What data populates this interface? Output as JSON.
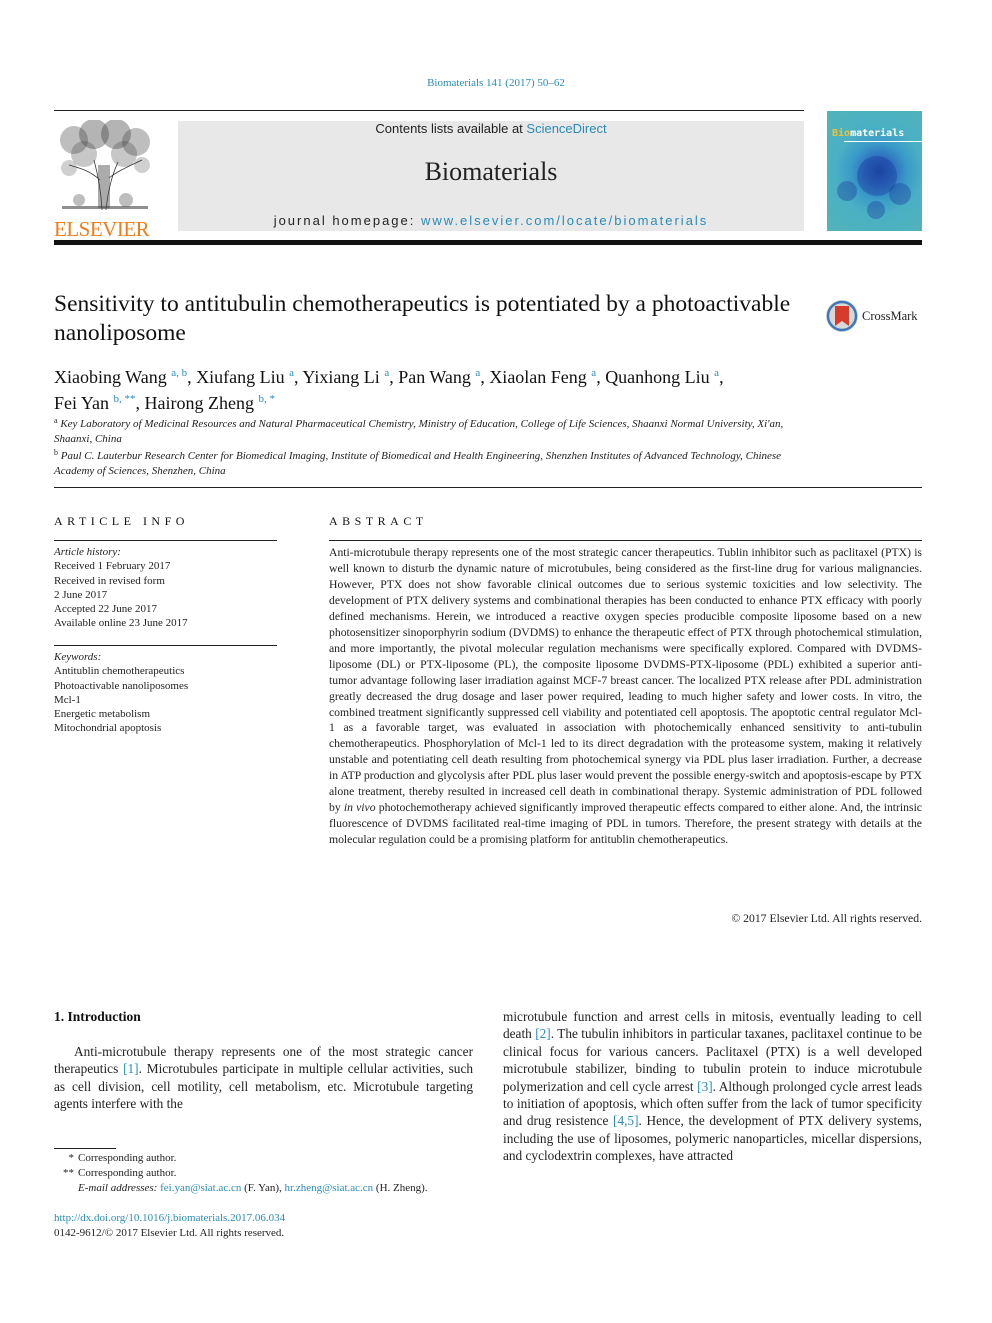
{
  "header": {
    "citation": "Biomaterials 141 (2017) 50–62",
    "publisher_logo_text": "ELSEVIER",
    "contents_prefix": "Contents lists available at ",
    "contents_link": "ScienceDirect",
    "journal_title": "Biomaterials",
    "homepage_prefix": "journal homepage: ",
    "homepage_link": "www.elsevier.com/locate/biomaterials",
    "cover_title_highlight": "Bio",
    "cover_title_rest": "materials",
    "colors": {
      "link": "#2a8bb8",
      "elsevier_orange": "#f07c1a"
    }
  },
  "article": {
    "title": "Sensitivity to antitubulin chemotherapeutics is potentiated by a photoactivable nanoliposome",
    "crossmark_label": "CrossMark",
    "authors": [
      {
        "name": "Xiaobing Wang",
        "sup": "a, b",
        "sep": ", "
      },
      {
        "name": "Xiufang Liu",
        "sup": "a",
        "sep": ", "
      },
      {
        "name": "Yixiang Li",
        "sup": "a",
        "sep": ", "
      },
      {
        "name": "Pan Wang",
        "sup": "a",
        "sep": ", "
      },
      {
        "name": "Xiaolan Feng",
        "sup": "a",
        "sep": ", "
      },
      {
        "name": "Quanhong Liu",
        "sup": "a",
        "sep": ","
      },
      {
        "name": "Fei Yan",
        "sup": "b, **",
        "sep": ", "
      },
      {
        "name": "Hairong Zheng",
        "sup": "b, *",
        "sep": ""
      }
    ],
    "affiliations": [
      {
        "mark": "a",
        "text": "Key Laboratory of Medicinal Resources and Natural Pharmaceutical Chemistry, Ministry of Education, College of Life Sciences, Shaanxi Normal University, Xi'an, Shaanxi, China"
      },
      {
        "mark": "b",
        "text": "Paul C. Lauterbur Research Center for Biomedical Imaging, Institute of Biomedical and Health Engineering, Shenzhen Institutes of Advanced Technology, Chinese Academy of Sciences, Shenzhen, China"
      }
    ]
  },
  "article_info": {
    "heading": "ARTICLE INFO",
    "history_label": "Article history:",
    "history": [
      "Received 1 February 2017",
      "Received in revised form",
      "2 June 2017",
      "Accepted 22 June 2017",
      "Available online 23 June 2017"
    ],
    "keywords_label": "Keywords:",
    "keywords": [
      "Antitublin chemotherapeutics",
      "Photoactivable nanoliposomes",
      "Mcl-1",
      "Energetic metabolism",
      "Mitochondrial apoptosis"
    ]
  },
  "abstract": {
    "heading": "ABSTRACT",
    "part1": "Anti-microtubule therapy represents one of the most strategic cancer therapeutics. Tublin inhibitor such as paclitaxel (PTX) is well known to disturb the dynamic nature of microtubules, being considered as the first-line drug for various malignancies. However, PTX does not show favorable clinical outcomes due to serious systemic toxicities and low selectivity. The development of PTX delivery systems and combi­national therapies has been conducted to enhance PTX efficacy with poorly defined mechanisms. Herein, we introduced a reactive oxygen species producible composite liposome based on a new photosensitizer sinoporphyrin sodium (DVDMS) to enhance the therapeutic effect of PTX through photochemical stim­ulation, and more importantly, the pivotal molecular regulation mechanisms were specifically explored. Compared with DVDMS-liposome (DL) or PTX-liposome (PL), the composite liposome DVDMS-PTX-liposome (PDL) exhibited a superior anti-tumor advantage following laser irradiation against MCF-7 breast cancer. The localized PTX release after PDL administration greatly decreased the drug dosage and laser power required, leading to much higher safety and lower costs. In vitro, the combined treat­ment significantly suppressed cell viability and potentiated cell apoptosis. The apoptotic central regulator Mcl-1 as a favorable target, was evaluated in association with photochemically enhanced sensitivity to anti-tubulin chemotherapeutics. Phosphorylation of Mcl-1 led to its direct degradation with the pro­teasome system, making it relatively unstable and potentiating cell death resulting from photochemical synergy via PDL plus laser irradiation. Further, a decrease in ATP production and glycolysis after PDL plus laser would prevent the possible energy-switch and apoptosis-escape by PTX alone treatment, thereby resulted in increased cell death in combinational therapy. Systemic administration of PDL followed by ",
    "italic": "in vivo",
    "part2": " photochemotherapy achieved significantly improved therapeutic effects compared to either alone. And, the intrinsic fluorescence of DVDMS facilitated real-time imaging of PDL in tumors. Therefore, the present strategy with details at the molecular regulation could be a promising platform for antitublin chemotherapeutics.",
    "copyright": "© 2017 Elsevier Ltd. All rights reserved."
  },
  "introduction": {
    "heading": "1.  Introduction",
    "col1": [
      {
        "t": "Anti-microtubule therapy represents one of the most strategic cancer therapeutics "
      },
      {
        "ref": "[1]"
      },
      {
        "t": ". Microtubules participate in multiple cellular activities, such as cell division, cell motility, cell meta­bolism, etc. Microtubule targeting agents interfere with the"
      }
    ],
    "col2": [
      {
        "t": "microtubule function and arrest cells in mitosis, eventually leading to cell death "
      },
      {
        "ref": "[2]"
      },
      {
        "t": ". The tubulin inhibitors in particular taxanes, paclitaxel continue to be clinical focus for various cancers. Pacli­taxel (PTX) is a well developed microtubule stabilizer, binding to tubulin protein to induce microtubule polymerization and cell cycle arrest "
      },
      {
        "ref": "[3]"
      },
      {
        "t": ". Although prolonged cycle arrest leads to initiation of apoptosis, which often suffer from the lack of tumor specificity and drug resistence "
      },
      {
        "ref": "[4,5]"
      },
      {
        "t": ". Hence, the development of PTX delivery systems, including the use of liposomes, polymeric nanoparticles, micellar dispersions, and cyclodextrin complexes, have attracted"
      }
    ]
  },
  "footnotes": {
    "star1_mark": "*",
    "star1_text": "Corresponding author.",
    "star2_mark": "**",
    "star2_text": "Corresponding author.",
    "email_label": "E-mail addresses:",
    "email1": "fei.yan@siat.ac.cn",
    "email1_owner": " (F. Yan), ",
    "email2": "hr.zheng@siat.ac.cn",
    "email2_owner": " (H. Zheng).",
    "doi": "http://dx.doi.org/10.1016/j.biomaterials.2017.06.034",
    "issn": "0142-9612/© 2017 Elsevier Ltd. All rights reserved."
  }
}
